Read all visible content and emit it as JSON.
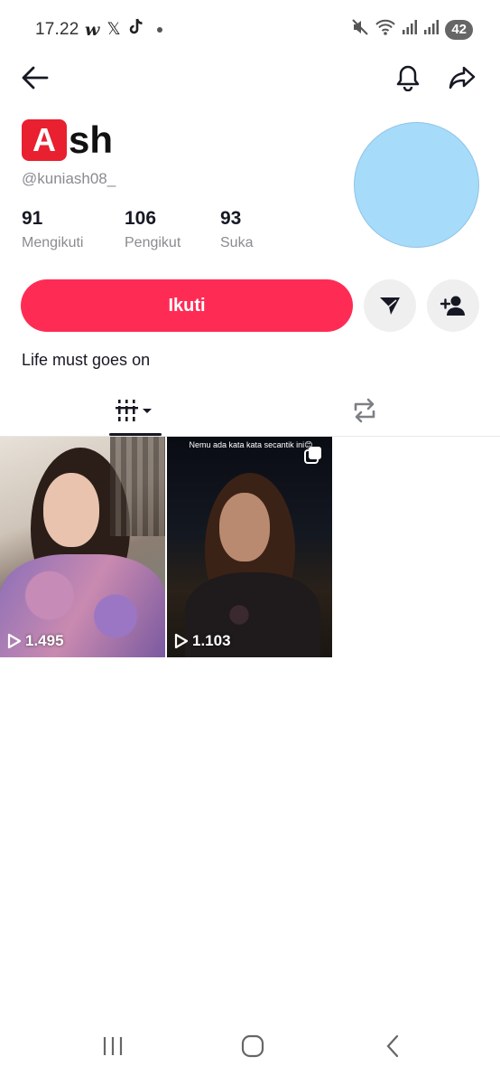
{
  "status_bar": {
    "time": "17.22",
    "left_icons": [
      "w-icon",
      "x-icon",
      "tiktok-icon",
      "dot"
    ],
    "right_icons": [
      "mute-icon",
      "wifi-icon",
      "signal-icon",
      "signal-icon"
    ],
    "battery": "42"
  },
  "profile": {
    "name_badge_letter": "A",
    "name_rest": "sh",
    "username": "@kuniash08_",
    "stats": [
      {
        "value": "91",
        "label": "Mengikuti"
      },
      {
        "value": "106",
        "label": "Pengikut"
      },
      {
        "value": "93",
        "label": "Suka"
      }
    ],
    "follow_label": "Ikuti",
    "bio": "Life must goes on",
    "avatar_color": "#a6dbfa",
    "accent_color": "#fe2c55"
  },
  "videos": [
    {
      "views": "1.495",
      "caption": ""
    },
    {
      "views": "1.103",
      "caption": "Nemu ada kata kata secantik ini😊"
    }
  ]
}
